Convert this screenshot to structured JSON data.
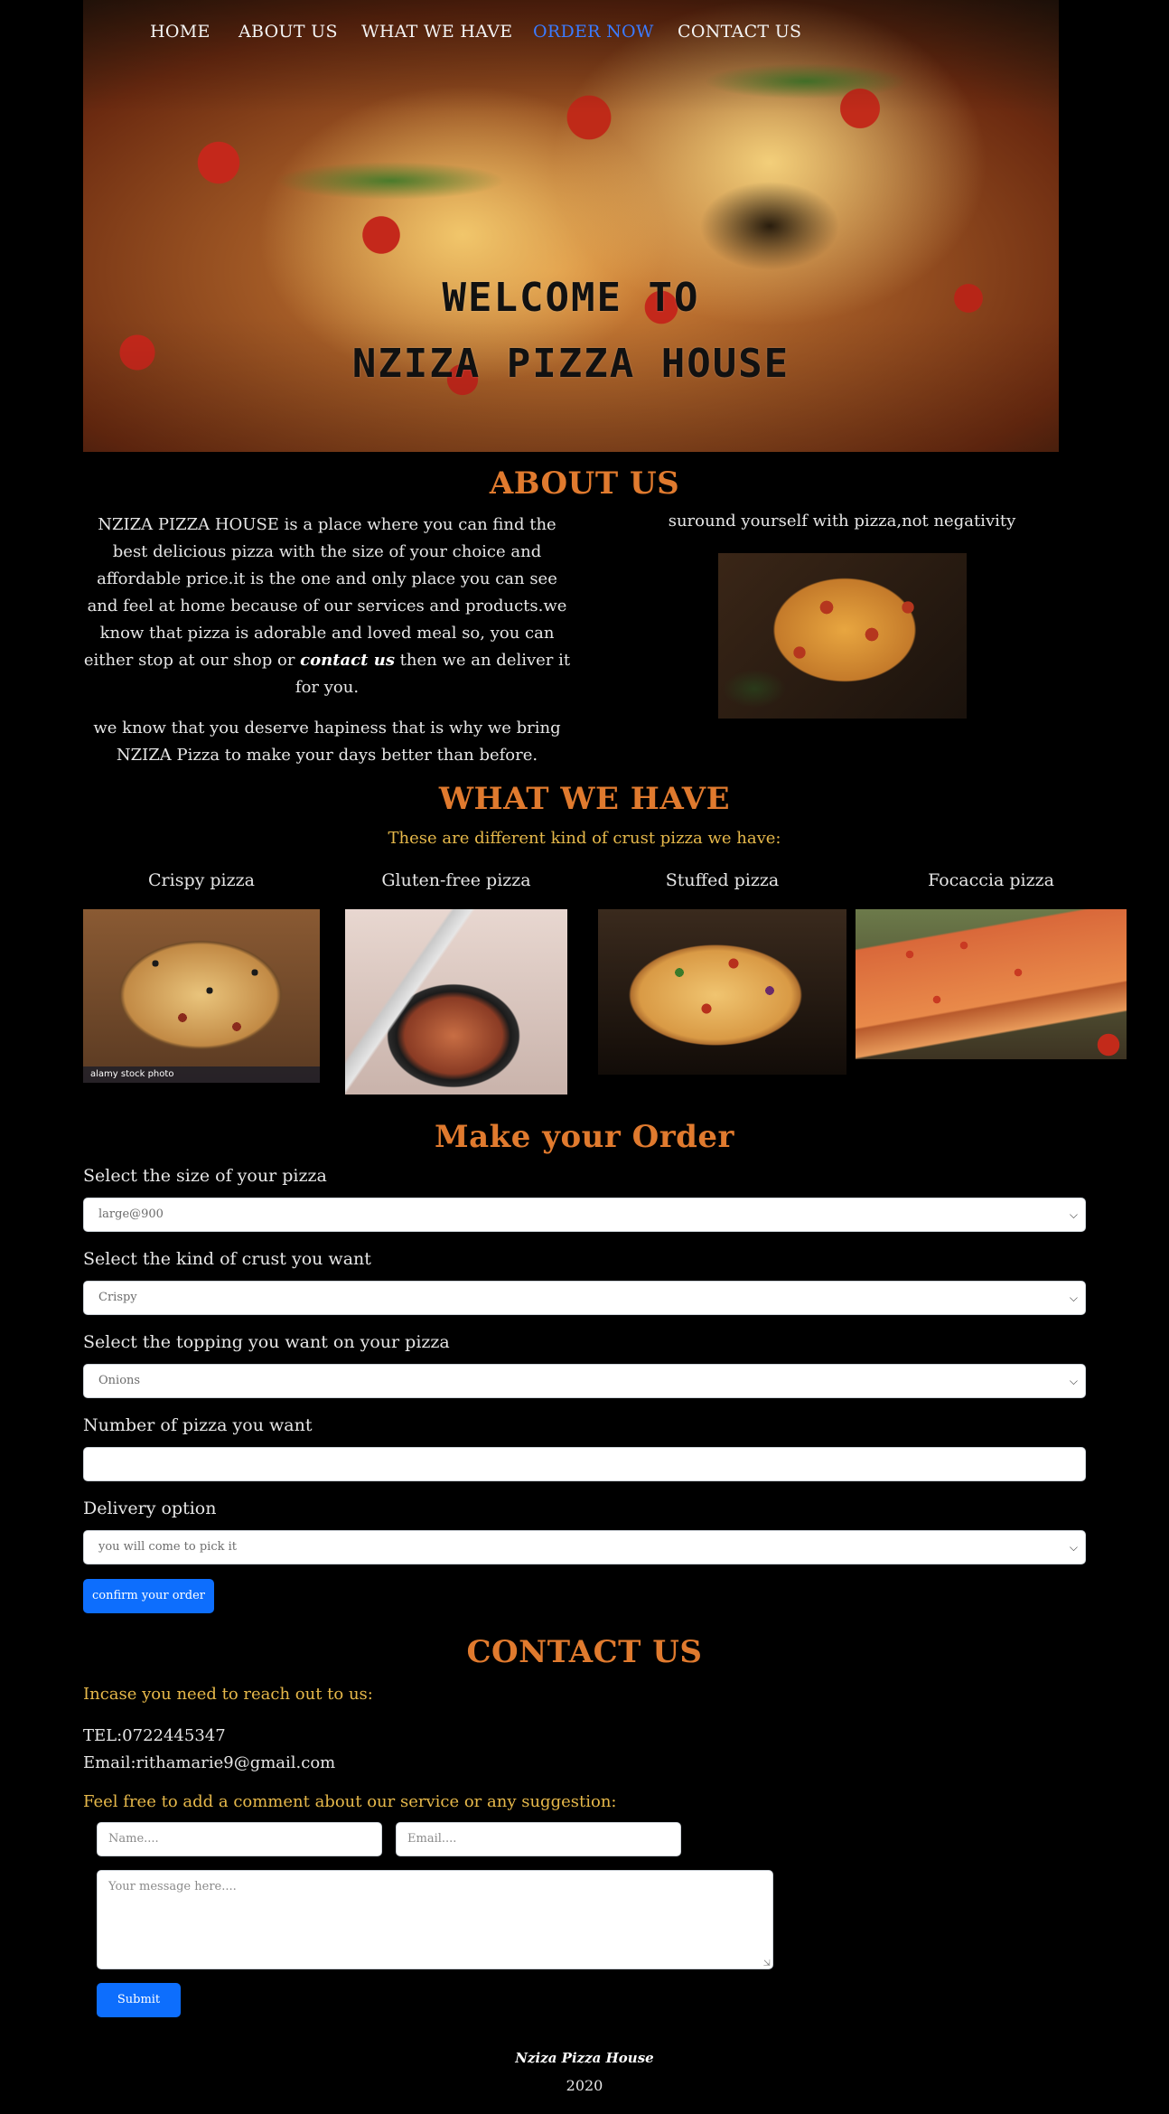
{
  "nav": {
    "items": [
      {
        "label": "HOME"
      },
      {
        "label": "ABOUT US"
      },
      {
        "label": "WHAT WE HAVE"
      },
      {
        "label": "ORDER NOW"
      },
      {
        "label": "CONTACT US"
      }
    ],
    "active_color": "#3b7bff"
  },
  "hero": {
    "line1": "WELCOME TO",
    "line2": "NZIZA PIZZA HOUSE"
  },
  "about": {
    "title": "ABOUT US",
    "paragraph1_before": "NZIZA PIZZA HOUSE is a place where you can find the best delicious pizza with the size of your choice and affordable price.it is the one and only place you can see and feel at home because of our services and products.we know that pizza is adorable and loved meal so, you can either stop at our shop or ",
    "paragraph1_link": "contact us",
    "paragraph1_after": " then we an deliver it for you.",
    "paragraph2": "we know that you deserve hapiness that is why we bring NZIZA Pizza to make your days better than before.",
    "caption": "suround yourself with pizza,not negativity"
  },
  "what_we_have": {
    "title": "WHAT WE HAVE",
    "subtitle": "These are different kind of crust pizza we have:",
    "crusts": [
      {
        "label": "Crispy pizza"
      },
      {
        "label": "Gluten-free pizza"
      },
      {
        "label": "Stuffed pizza"
      },
      {
        "label": "Focaccia pizza"
      }
    ],
    "watermark": "alamy stock photo"
  },
  "order": {
    "title": "Make your Order",
    "size_label": "Select the size of your pizza",
    "size_value": "large@900",
    "crust_label": "Select the kind of crust you want",
    "crust_value": "Crispy",
    "topping_label": "Select the topping you want on your pizza",
    "topping_value": "Onions",
    "number_label": "Number of pizza you want",
    "number_value": "",
    "delivery_label": "Delivery option",
    "delivery_value": "you will come to pick it",
    "confirm_button": "confirm your order"
  },
  "contact": {
    "title": "CONTACT US",
    "reach_text": "Incase you need to reach out to us:",
    "tel": "TEL:0722445347",
    "email": "Email:rithamarie9@gmail.com",
    "comment_text": "Feel free to add a comment about our service or any suggestion:",
    "name_placeholder": "Name....",
    "email_placeholder": "Email....",
    "message_placeholder": "Your message here....",
    "submit_button": "Submit"
  },
  "footer": {
    "brand": "Nziza Pizza House",
    "year": "2020"
  },
  "colors": {
    "heading": "#e07a2e",
    "gold": "#e6b84a",
    "primary_button": "#0d6efd",
    "background": "#000000"
  }
}
